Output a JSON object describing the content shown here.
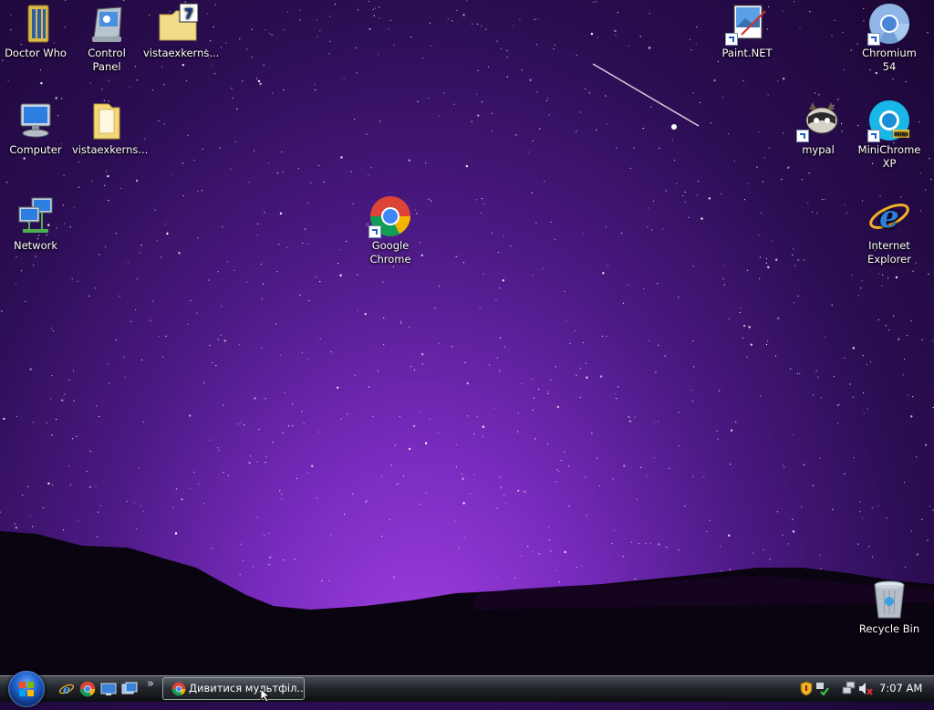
{
  "desktop": {
    "icons": [
      {
        "id": "doctor-who",
        "label": "Doctor Who",
        "icon": "folder-icon"
      },
      {
        "id": "control-panel",
        "label": "Control Panel",
        "icon": "control-panel-icon"
      },
      {
        "id": "vistaexkerns-archive",
        "label": "vistaexkerns...",
        "icon": "7zip-archive-icon"
      },
      {
        "id": "computer",
        "label": "Computer",
        "icon": "computer-icon"
      },
      {
        "id": "vistaexkerns-folder",
        "label": "vistaexkerns...",
        "icon": "folder-icon"
      },
      {
        "id": "network",
        "label": "Network",
        "icon": "network-icon"
      },
      {
        "id": "google-chrome",
        "label": "Google Chrome",
        "icon": "chrome-icon"
      },
      {
        "id": "paint-net",
        "label": "Paint.NET",
        "icon": "paint-net-icon"
      },
      {
        "id": "chromium",
        "label": "Chromium 54",
        "icon": "chromium-icon"
      },
      {
        "id": "mypal",
        "label": "mypal",
        "icon": "mypal-icon"
      },
      {
        "id": "minichrome",
        "label": "MiniChrome XP",
        "icon": "minichrome-icon"
      },
      {
        "id": "internet-explorer",
        "label": "Internet Explorer",
        "icon": "internet-explorer-icon"
      },
      {
        "id": "recycle-bin",
        "label": "Recycle Bin",
        "icon": "recycle-bin-icon"
      }
    ]
  },
  "taskbar": {
    "start_icon": "windows-start-orb",
    "quick_launch": [
      "internet-explorer-icon",
      "chrome-icon",
      "show-desktop-icon",
      "switch-windows-icon"
    ],
    "overflow_glyph": "»",
    "task_button": {
      "label": "Дивитися мультфіл...",
      "icon": "chrome-icon"
    },
    "tray_icons": [
      "security-shield-icon",
      "network-tray-icon",
      "network-connection-icon",
      "volume-muted-icon"
    ],
    "clock": "7:07 AM"
  }
}
